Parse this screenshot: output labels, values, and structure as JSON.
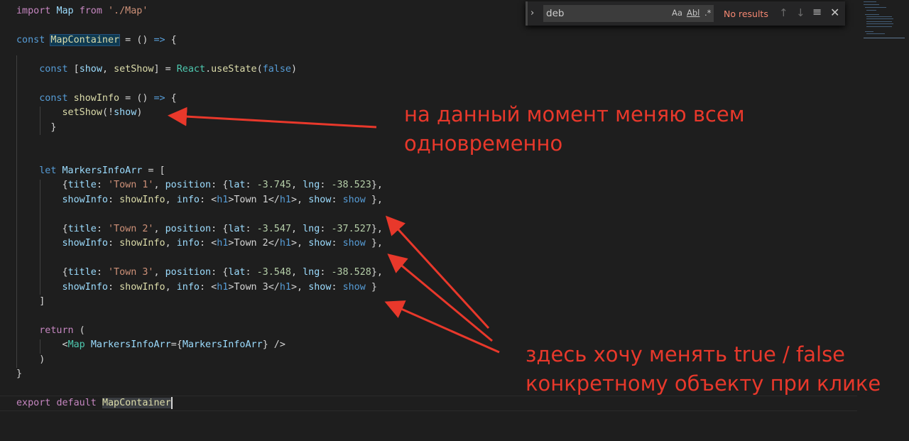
{
  "code_lines": [
    [
      {
        "t": "import",
        "c": "kwc"
      },
      {
        "t": " "
      },
      {
        "t": "Map",
        "c": "var"
      },
      {
        "t": " "
      },
      {
        "t": "from",
        "c": "kwc"
      },
      {
        "t": " "
      },
      {
        "t": "'./Map'",
        "c": "str"
      }
    ],
    [],
    [
      {
        "t": "const",
        "c": "kw"
      },
      {
        "t": " "
      },
      {
        "t": "MapContainer",
        "c": "fn hl-word"
      },
      {
        "t": " = () "
      },
      {
        "t": "=>",
        "c": "kw"
      },
      {
        "t": " {"
      }
    ],
    [],
    [
      {
        "t": "    "
      },
      {
        "t": "const",
        "c": "kw"
      },
      {
        "t": " ["
      },
      {
        "t": "show",
        "c": "var"
      },
      {
        "t": ", "
      },
      {
        "t": "setShow",
        "c": "fn"
      },
      {
        "t": "] = "
      },
      {
        "t": "React",
        "c": "cls"
      },
      {
        "t": "."
      },
      {
        "t": "useState",
        "c": "fn"
      },
      {
        "t": "("
      },
      {
        "t": "false",
        "c": "kw"
      },
      {
        "t": ")"
      }
    ],
    [],
    [
      {
        "t": "    "
      },
      {
        "t": "const",
        "c": "kw"
      },
      {
        "t": " "
      },
      {
        "t": "showInfo",
        "c": "fn"
      },
      {
        "t": " = () "
      },
      {
        "t": "=>",
        "c": "kw"
      },
      {
        "t": " {"
      }
    ],
    [
      {
        "t": "        "
      },
      {
        "t": "setShow",
        "c": "fn"
      },
      {
        "t": "(!"
      },
      {
        "t": "show",
        "c": "var"
      },
      {
        "t": ")"
      }
    ],
    [
      {
        "t": "      }"
      }
    ],
    [],
    [],
    [
      {
        "t": "    "
      },
      {
        "t": "let",
        "c": "kw"
      },
      {
        "t": " "
      },
      {
        "t": "MarkersInfoArr",
        "c": "var"
      },
      {
        "t": " = ["
      }
    ],
    [
      {
        "t": "        {"
      },
      {
        "t": "title",
        "c": "var"
      },
      {
        "t": ": "
      },
      {
        "t": "'Town 1'",
        "c": "str"
      },
      {
        "t": ", "
      },
      {
        "t": "position",
        "c": "var"
      },
      {
        "t": ": {"
      },
      {
        "t": "lat",
        "c": "var"
      },
      {
        "t": ": "
      },
      {
        "t": "-3.745",
        "c": "num"
      },
      {
        "t": ", "
      },
      {
        "t": "lng",
        "c": "var"
      },
      {
        "t": ": "
      },
      {
        "t": "-38.523",
        "c": "num"
      },
      {
        "t": "},"
      }
    ],
    [
      {
        "t": "        "
      },
      {
        "t": "showInfo",
        "c": "var"
      },
      {
        "t": ": "
      },
      {
        "t": "showInfo",
        "c": "fn"
      },
      {
        "t": ", "
      },
      {
        "t": "info",
        "c": "var"
      },
      {
        "t": ": "
      },
      {
        "t": "<",
        "c": "br"
      },
      {
        "t": "h1",
        "c": "tag"
      },
      {
        "t": ">Town 1</"
      },
      {
        "t": "h1",
        "c": "tag"
      },
      {
        "t": ">, "
      },
      {
        "t": "show",
        "c": "var"
      },
      {
        "t": ": "
      },
      {
        "t": "show",
        "c": "kw"
      },
      {
        "t": " },"
      }
    ],
    [],
    [
      {
        "t": "        {"
      },
      {
        "t": "title",
        "c": "var"
      },
      {
        "t": ": "
      },
      {
        "t": "'Town 2'",
        "c": "str"
      },
      {
        "t": ", "
      },
      {
        "t": "position",
        "c": "var"
      },
      {
        "t": ": {"
      },
      {
        "t": "lat",
        "c": "var"
      },
      {
        "t": ": "
      },
      {
        "t": "-3.547",
        "c": "num"
      },
      {
        "t": ", "
      },
      {
        "t": "lng",
        "c": "var"
      },
      {
        "t": ": "
      },
      {
        "t": "-37.527",
        "c": "num"
      },
      {
        "t": "},"
      }
    ],
    [
      {
        "t": "        "
      },
      {
        "t": "showInfo",
        "c": "var"
      },
      {
        "t": ": "
      },
      {
        "t": "showInfo",
        "c": "fn"
      },
      {
        "t": ", "
      },
      {
        "t": "info",
        "c": "var"
      },
      {
        "t": ": "
      },
      {
        "t": "<",
        "c": "br"
      },
      {
        "t": "h1",
        "c": "tag"
      },
      {
        "t": ">Town 2</"
      },
      {
        "t": "h1",
        "c": "tag"
      },
      {
        "t": ">, "
      },
      {
        "t": "show",
        "c": "var"
      },
      {
        "t": ": "
      },
      {
        "t": "show",
        "c": "kw"
      },
      {
        "t": " },"
      }
    ],
    [],
    [
      {
        "t": "        {"
      },
      {
        "t": "title",
        "c": "var"
      },
      {
        "t": ": "
      },
      {
        "t": "'Town 3'",
        "c": "str"
      },
      {
        "t": ", "
      },
      {
        "t": "position",
        "c": "var"
      },
      {
        "t": ": {"
      },
      {
        "t": "lat",
        "c": "var"
      },
      {
        "t": ": "
      },
      {
        "t": "-3.548",
        "c": "num"
      },
      {
        "t": ", "
      },
      {
        "t": "lng",
        "c": "var"
      },
      {
        "t": ": "
      },
      {
        "t": "-38.528",
        "c": "num"
      },
      {
        "t": "},"
      }
    ],
    [
      {
        "t": "        "
      },
      {
        "t": "showInfo",
        "c": "var"
      },
      {
        "t": ": "
      },
      {
        "t": "showInfo",
        "c": "fn"
      },
      {
        "t": ", "
      },
      {
        "t": "info",
        "c": "var"
      },
      {
        "t": ": "
      },
      {
        "t": "<",
        "c": "br"
      },
      {
        "t": "h1",
        "c": "tag"
      },
      {
        "t": ">Town 3</"
      },
      {
        "t": "h1",
        "c": "tag"
      },
      {
        "t": ">, "
      },
      {
        "t": "show",
        "c": "var"
      },
      {
        "t": ": "
      },
      {
        "t": "show",
        "c": "kw"
      },
      {
        "t": " }"
      }
    ],
    [
      {
        "t": "    ]"
      }
    ],
    [],
    [
      {
        "t": "    "
      },
      {
        "t": "return",
        "c": "kwc"
      },
      {
        "t": " ("
      }
    ],
    [
      {
        "t": "        "
      },
      {
        "t": "<",
        "c": "br"
      },
      {
        "t": "Map",
        "c": "cls"
      },
      {
        "t": " "
      },
      {
        "t": "MarkersInfoArr",
        "c": "var"
      },
      {
        "t": "={"
      },
      {
        "t": "MarkersInfoArr",
        "c": "var"
      },
      {
        "t": "} />"
      }
    ],
    [
      {
        "t": "    )"
      }
    ],
    [
      {
        "t": "}"
      }
    ],
    [],
    [
      {
        "t": "export",
        "c": "kwc"
      },
      {
        "t": " "
      },
      {
        "t": "default",
        "c": "kwc"
      },
      {
        "t": " "
      },
      {
        "t": "MapContainer",
        "c": "fn sel-word"
      }
    ]
  ],
  "find": {
    "query": "deb",
    "status": "No results",
    "toggle_glyph": "›",
    "match_case": "Aa",
    "whole_word": "Abl",
    "regex": ".*",
    "prev_glyph": "↑",
    "next_glyph": "↓",
    "selection_glyph": "≡",
    "close_glyph": "✕"
  },
  "annotations": {
    "top": "на данный момент меняю всем\nодновременно",
    "bottom": "здесь хочу менять true / false\nконкретному объекту при клике"
  },
  "annotation_color": "#e8382b"
}
